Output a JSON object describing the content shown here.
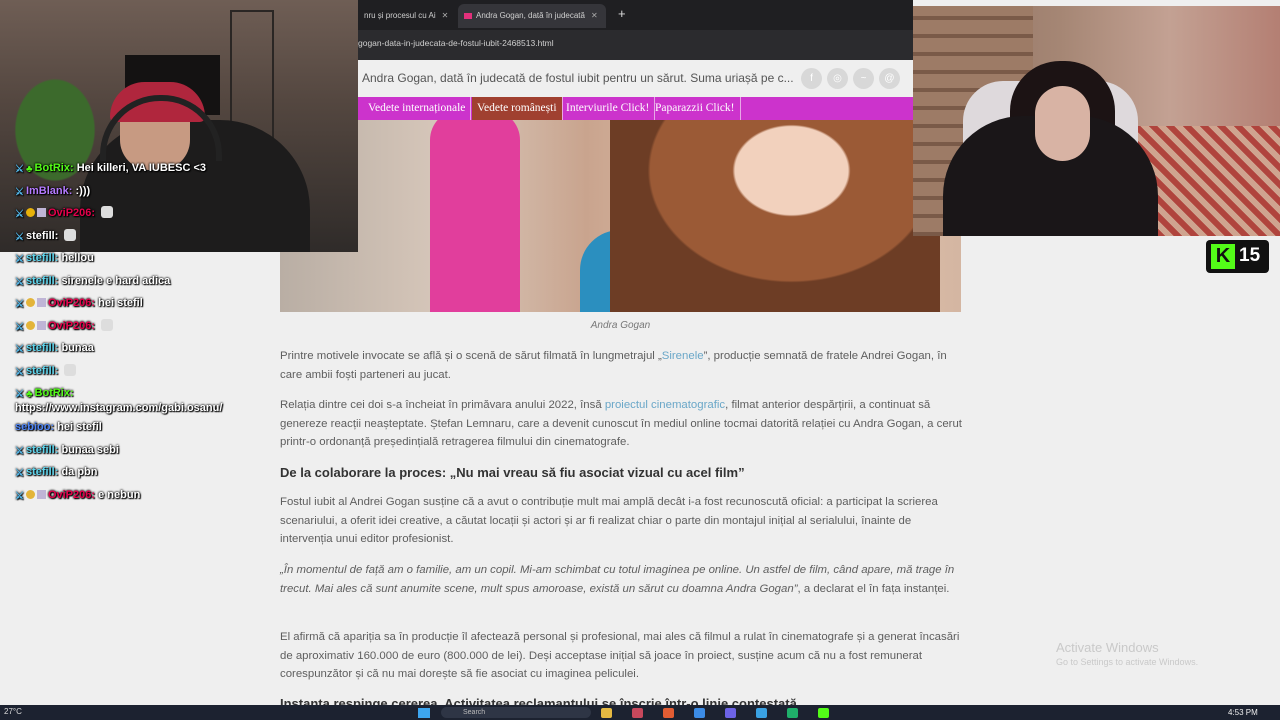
{
  "browser": {
    "tabs": [
      {
        "label": "nru și procesul cu Ai"
      },
      {
        "label": "Andra Gogan, dată în judecată"
      }
    ],
    "url": "gogan-data-in-judecata-de-fostul-iubit-2468513.html",
    "site_title": "Andra Gogan, dată în judecată de fostul iubit pentru un sărut. Suma uriașă pe c...",
    "nav": [
      "Vedete internaționale",
      "Vedete românești",
      "Interviurile Click!",
      "Paparazzii Click!"
    ],
    "active_nav": "Vedete românești"
  },
  "article": {
    "caption": "Andra Gogan",
    "p1_before": "Printre motivele invocate se află și o scenă de sărut filmată în lungmetrajul „",
    "p1_link": "Sirenele",
    "p1_after": "”, producție semnată de fratele Andrei Gogan, în care ambii foști parteneri au jucat.",
    "p2_before": "Relația dintre cei doi s-a încheiat în primăvara anului 2022, însă ",
    "p2_link": "proiectul cinematografic",
    "p2_after": ", filmat anterior despărțirii, a continuat să genereze reacții neașteptate. Ștefan Lemnaru, care a devenit cunoscut în mediul online tocmai datorită relației cu Andra Gogan, a cerut printr-o ordonanță președințială retragerea filmului din cinematografe.",
    "heading": "De la colaborare la proces: „Nu mai vreau să fiu asociat vizual cu acel film”",
    "p3": "Fostul iubit al Andrei Gogan susține că a avut o contribuție mult mai amplă decât i-a fost recunoscută oficial: a participat la scrierea scenariului, a oferit idei creative, a căutat locații și actori și ar fi realizat chiar o parte din montajul inițial al serialului, înainte de intervenția unui editor profesionist.",
    "p4_quote": "„În momentul de față am o familie, am un copil. Mi-am schimbat cu totul imaginea pe online. Un astfel de film, când apare, mă trage în trecut. Mai ales că sunt anumite scene, mult spus amoroase, există un sărut cu doamna Andra Gogan”",
    "p4_after": ", a declarat el în fața instanței.",
    "p5": "El afirmă că apariția sa în producție îl afectează personal și profesional, mai ales că filmul a rulat în cinematografe și a generat încasări de aproximativ 160.000 de euro (800.000 de lei). Deși acceptase inițial să joace în proiect, susține acum că nu a fost remunerat corespunzător și că nu mai dorește să fie asociat cu imaginea peliculei.",
    "heading2": "Instanța respinge cererea. Activitatea reclamantului se înscrie într-o linie contestată"
  },
  "kick": {
    "logo": "K",
    "viewers": "15"
  },
  "chat": [
    {
      "user": "BotRix",
      "color": "#53fc18",
      "badges": [
        "sword",
        "bot"
      ],
      "text": "Hei killeri, VA IUBESC <3"
    },
    {
      "user": "ImBlank",
      "color": "#b57bff",
      "badges": [
        "sword"
      ],
      "text": ":)))"
    },
    {
      "user": "OviP206",
      "color": "#e6004c",
      "badges": [
        "sword",
        "warn",
        "sub"
      ],
      "text": "",
      "emote": true
    },
    {
      "user": "stefill",
      "color": "#ffffff",
      "badges": [
        "sword"
      ],
      "text": "",
      "emote": true
    },
    {
      "user": "stefill",
      "color": "#5ed6ee",
      "badges": [
        "sword"
      ],
      "text": "hellou"
    },
    {
      "user": "stefill",
      "color": "#5ed6ee",
      "badges": [
        "sword"
      ],
      "text": "sirenele e hard adica"
    },
    {
      "user": "OviP206",
      "color": "#e6004c",
      "badges": [
        "sword",
        "gift",
        "sub"
      ],
      "text": "hei stefil"
    },
    {
      "user": "OviP206",
      "color": "#e6004c",
      "badges": [
        "sword",
        "gift",
        "sub"
      ],
      "text": "",
      "emote": true
    },
    {
      "user": "stefill",
      "color": "#5ed6ee",
      "badges": [
        "sword"
      ],
      "text": "bunaa"
    },
    {
      "user": "stefill",
      "color": "#5ed6ee",
      "badges": [
        "sword"
      ],
      "text": "",
      "emote": true
    },
    {
      "user": "BotRix",
      "color": "#53fc18",
      "badges": [
        "sword",
        "bot"
      ],
      "text": "https://www.instagram.com/gabi.osanu/",
      "wrap": true
    },
    {
      "user": "sebioo",
      "color": "#4f86f7",
      "badges": [],
      "text": "hei stefil"
    },
    {
      "user": "stefill",
      "color": "#5ed6ee",
      "badges": [
        "sword"
      ],
      "text": "bunaa sebi"
    },
    {
      "user": "stefill",
      "color": "#5ed6ee",
      "badges": [
        "sword"
      ],
      "text": "da pbn"
    },
    {
      "user": "OviP206",
      "color": "#e6004c",
      "badges": [
        "sword",
        "gift",
        "sub"
      ],
      "text": "e nebun"
    }
  ],
  "watermark": {
    "line1": "Activate Windows",
    "line2": "Go to Settings to activate Windows."
  },
  "taskbar": {
    "weather": "27°C",
    "search": "Search",
    "time": "4:53 PM"
  },
  "colors": {
    "nav_bg": "#cc33cc",
    "nav_active": "#a04030",
    "kick_green": "#53fc18",
    "link": "#6aa7c8"
  }
}
